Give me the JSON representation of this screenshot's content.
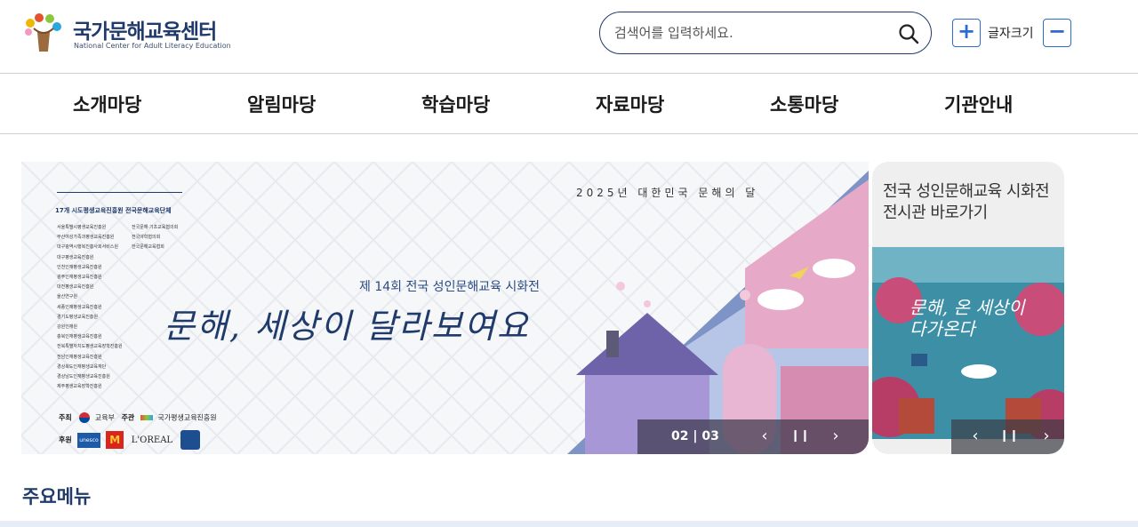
{
  "header": {
    "logo_title": "국가문해교육센터",
    "logo_subtitle": "National Center for Adult Literacy Education",
    "search_placeholder": "검색어를 입력하세요.",
    "font_size_label": "글자크기",
    "font_plus": "+",
    "font_minus": "−"
  },
  "nav": {
    "items": [
      "소개마당",
      "알림마당",
      "학습마당",
      "자료마당",
      "소통마당",
      "기관안내"
    ]
  },
  "banner": {
    "org_heading": "17개 시도평생교육진흥원   전국문해교육단체",
    "org_left": [
      "서울특별시평생교육진흥원",
      "부산여성가족과평생교육진흥원",
      "대구광역시행복진흥사회서비스원",
      "대구평생교육진흥원",
      "인천인재평생교육진흥원",
      "광주인재평생교육진흥원",
      "대전평생교육진흥원",
      "울산연구원",
      "세종인재평생교육진흥원",
      "경기도평생교육진흥원",
      "강원인재원",
      "충북인재평생교육진흥원",
      "전북특별자치도평생교육장학진흥원",
      "전남인재평생교육진흥원",
      "경상북도인재평생교육재단",
      "경상남도인재평생교육진흥원",
      "제주평생교육장학진흥원"
    ],
    "org_right": [
      "전국문해·기초교육협의회",
      "전국야학협의회",
      "한국문해교육협회"
    ],
    "host_label": "주최",
    "host_value": "교육부",
    "organizer_label": "주관",
    "organizer_value": "국가평생교육진흥원",
    "sponsor_label": "후원",
    "sponsor_values": [
      "unesco",
      "M",
      "L'OREAL"
    ],
    "year_text": "2025년 대한민국 문해의 달",
    "subtitle": "제 14회 전국 성인문해교육 시화전",
    "title": "문해, 세상이 달라보여요",
    "counter": "02 | 03",
    "prev_icon": "‹",
    "pause_icon": "❙❙",
    "next_icon": "›"
  },
  "side": {
    "title": "전국 성인문해교육 시화전 전시관 바로가기",
    "poster_text": "문해, 온 세상이 다가온다",
    "prev_icon": "‹",
    "pause_icon": "❙❙",
    "next_icon": "›"
  },
  "main_menu": {
    "title": "주요메뉴"
  },
  "colors": {
    "brand": "#1f3a6b",
    "accent": "#2d6bd0"
  }
}
